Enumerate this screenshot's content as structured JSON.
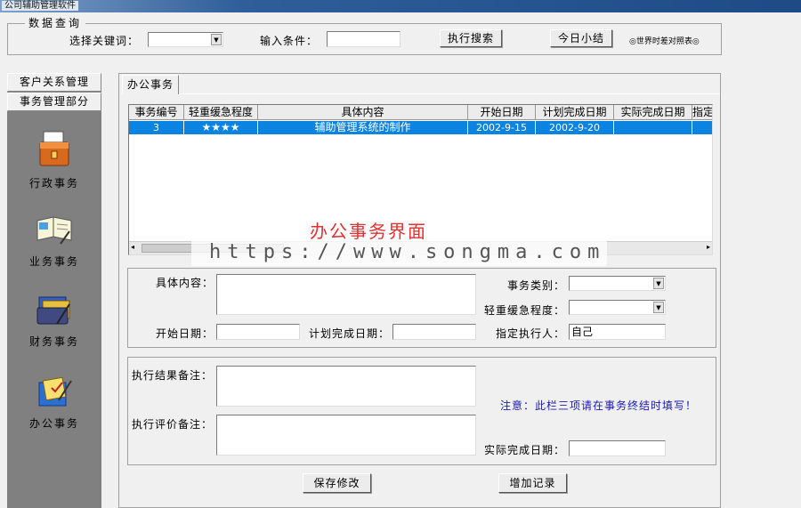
{
  "window": {
    "title": "公司辅助管理软件"
  },
  "search": {
    "legend": "数据查询",
    "keyword_label": "选择关键词：",
    "keyword_value": "",
    "condition_label": "输入条件：",
    "condition_value": "",
    "search_button": "执行搜索",
    "daily_summary_button": "今日小结",
    "world_time_link": "◎世界时差对照表◎"
  },
  "sidebar": {
    "tabs": [
      "客户关系管理",
      "事务管理部分"
    ],
    "items": [
      {
        "label": "行政事务",
        "icon": "folder-icon"
      },
      {
        "label": "业务事务",
        "icon": "notebook-icon"
      },
      {
        "label": "财务事务",
        "icon": "finance-icon"
      },
      {
        "label": "办公事务",
        "icon": "office-icon"
      }
    ]
  },
  "main": {
    "tab_label": "办公事务",
    "table": {
      "columns": [
        "事务编号",
        "轻重缓急程度",
        "具体内容",
        "开始日期",
        "计划完成日期",
        "实际完成日期",
        "指定"
      ],
      "rows": [
        {
          "id": "3",
          "priority": "★★★★",
          "content": "辅助管理系统的制作",
          "start": "2002-9-15",
          "planned": "2002-9-20",
          "actual": "",
          "assignee": ""
        }
      ]
    },
    "caption": "办公事务界面",
    "watermark": "https://www.songma.com",
    "form": {
      "content_label": "具体内容：",
      "content_value": "",
      "category_label": "事务类别：",
      "category_value": "",
      "priority_label": "轻重缓急程度：",
      "priority_value": "",
      "start_label": "开始日期：",
      "start_value": "",
      "planned_label": "计划完成日期：",
      "planned_value": "",
      "assignee_label": "指定执行人：",
      "assignee_value": "自己"
    },
    "result": {
      "result_note_label": "执行结果备注：",
      "result_note_value": "",
      "evaluation_label": "执行评价备注：",
      "evaluation_value": "",
      "notice": "注意：此栏三项请在事务终结时填写！",
      "actual_label": "实际完成日期：",
      "actual_value": ""
    },
    "buttons": {
      "save": "保存修改",
      "add": "增加记录"
    }
  },
  "colors": {
    "selection": "#0a84e0",
    "notice": "#1a1ab0",
    "caption": "#e03030"
  }
}
